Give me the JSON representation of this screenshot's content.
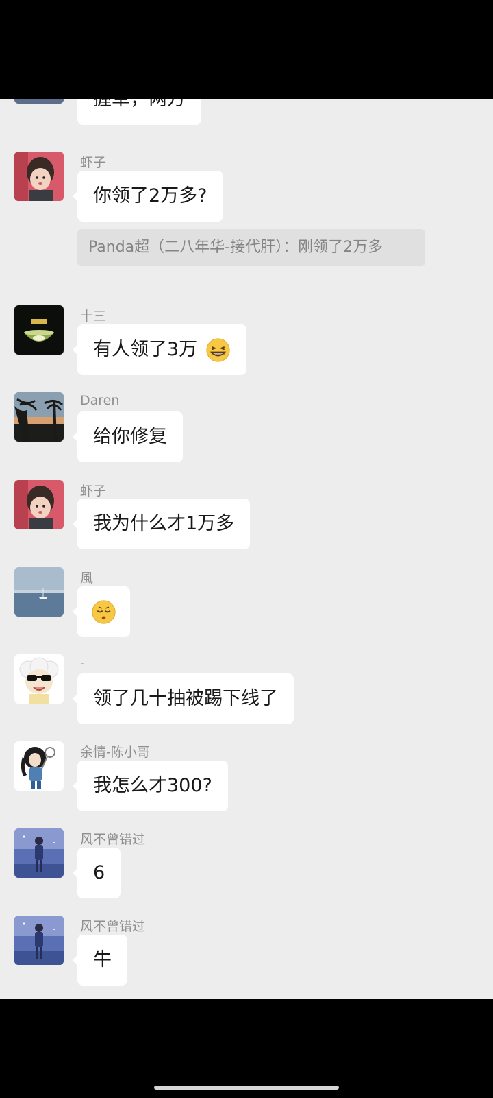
{
  "messages": [
    {
      "id": "m0",
      "text": "握草，两万"
    },
    {
      "id": "m1",
      "sender": "虾子",
      "text": "你领了2万多?",
      "quote": "Panda超（二八年华-接代肝）：刚领了2万多"
    },
    {
      "id": "m2",
      "sender": "十三",
      "text": "有人领了3万",
      "emoji": "grinning-squint-emoji"
    },
    {
      "id": "m3",
      "sender": "Daren",
      "text": "给你修复"
    },
    {
      "id": "m4",
      "sender": "虾子",
      "text": "我为什么才1万多"
    },
    {
      "id": "m5",
      "sender": "風",
      "emoji": "sleepy-emoji"
    },
    {
      "id": "m6",
      "sender": "-",
      "text": "领了几十抽被踢下线了"
    },
    {
      "id": "m7",
      "sender": "余情-陈小哥",
      "text": "我怎么才300?"
    },
    {
      "id": "m8",
      "sender": "风不曾错过",
      "text": "6"
    },
    {
      "id": "m9",
      "sender": "风不曾错过",
      "text": "牛"
    }
  ],
  "colors": {
    "chat_background": "#ededed",
    "bubble": "#ffffff",
    "quote_background": "#e0e0e0",
    "name_text": "#8f8f8f",
    "message_text": "#191919",
    "system_bars": "#000000"
  },
  "avatars": {
    "shrimp": "girl-photo-avatar",
    "thirteen": "bowl-logo-avatar",
    "daren": "sunset-palm-avatar",
    "feng": "sea-boat-avatar",
    "dash": "sheep-sunglasses-avatar",
    "yuqing": "cartoon-girl-avatar",
    "fengbuceng": "boy-sky-avatar"
  }
}
